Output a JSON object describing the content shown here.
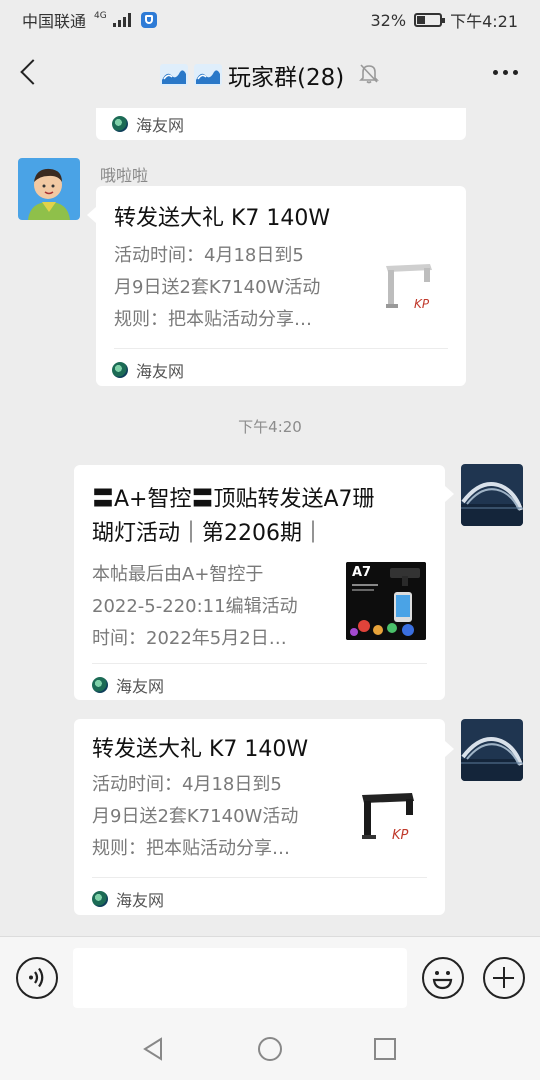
{
  "status_bar": {
    "carrier": "中国联通",
    "network": "4G",
    "battery_percent": "32%",
    "time": "下午4:21"
  },
  "header": {
    "title": "玩家群(28)",
    "title_icon": "wave-emoji-icon",
    "mute_icon": "bell-off-icon",
    "more_icon": "more-dots-icon"
  },
  "chat": {
    "partial_card": {
      "source": "海友网"
    },
    "message1": {
      "sender": "哦啦啦",
      "title": "转发送大礼 K7 140W",
      "desc_lines": [
        "活动时间：4月18日到5",
        "月9日送2套K7140W活动",
        "规则：把本贴活动分享…"
      ],
      "source": "海友网"
    },
    "time_separator": "下午4:20",
    "message2": {
      "title_lines": [
        "〓A+智控〓顶贴转发送A7珊",
        "瑚灯活动｜第2206期｜"
      ],
      "desc_lines": [
        "本帖最后由A+智控于",
        "2022-5-220:11编辑活动",
        "时间：2022年5月2日…"
      ],
      "thumb_label": "A7",
      "source": "海友网"
    },
    "message3": {
      "title": "转发送大礼 K7 140W",
      "desc_lines": [
        "活动时间：4月18日到5",
        "月9日送2套K7140W活动",
        "规则：把本贴活动分享…"
      ],
      "source": "海友网"
    }
  },
  "input_bar": {
    "value": "",
    "placeholder": ""
  },
  "colors": {
    "background": "#ededed",
    "card": "#ffffff",
    "secondary_text": "#7a7a7a"
  }
}
